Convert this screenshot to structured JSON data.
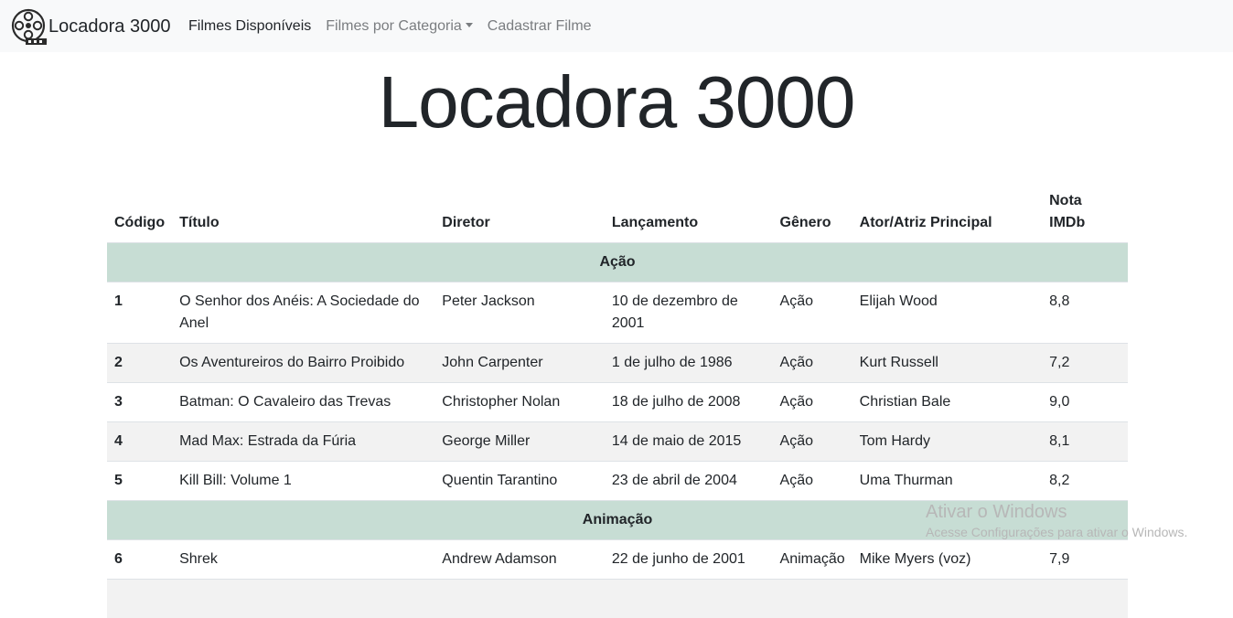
{
  "navbar": {
    "brand": "Locadora 3000",
    "links": [
      {
        "label": "Filmes Disponíveis"
      },
      {
        "label": "Filmes por Categoria"
      },
      {
        "label": "Cadastrar Filme"
      }
    ]
  },
  "page": {
    "title": "Locadora 3000"
  },
  "table": {
    "headers": [
      "Código",
      "Título",
      "Diretor",
      "Lançamento",
      "Gênero",
      "Ator/Atriz Principal",
      "Nota IMDb"
    ],
    "groups": [
      {
        "name": "Ação",
        "rows": [
          {
            "code": "1",
            "title": "O Senhor dos Anéis: A Sociedade do Anel",
            "director": "Peter Jackson",
            "release": "10 de dezembro de 2001",
            "genre": "Ação",
            "actor": "Elijah Wood",
            "rating": "8,8"
          },
          {
            "code": "2",
            "title": "Os Aventureiros do Bairro Proibido",
            "director": "John Carpenter",
            "release": "1 de julho de 1986",
            "genre": "Ação",
            "actor": "Kurt Russell",
            "rating": "7,2"
          },
          {
            "code": "3",
            "title": "Batman: O Cavaleiro das Trevas",
            "director": "Christopher Nolan",
            "release": "18 de julho de 2008",
            "genre": "Ação",
            "actor": "Christian Bale",
            "rating": "9,0"
          },
          {
            "code": "4",
            "title": "Mad Max: Estrada da Fúria",
            "director": "George Miller",
            "release": "14 de maio de 2015",
            "genre": "Ação",
            "actor": "Tom Hardy",
            "rating": "8,1"
          },
          {
            "code": "5",
            "title": "Kill Bill: Volume 1",
            "director": "Quentin Tarantino",
            "release": "23 de abril de 2004",
            "genre": "Ação",
            "actor": "Uma Thurman",
            "rating": "8,2"
          }
        ]
      },
      {
        "name": "Animação",
        "rows": [
          {
            "code": "6",
            "title": "Shrek",
            "director": "Andrew Adamson",
            "release": "22 de junho de 2001",
            "genre": "Animação",
            "actor": "Mike Myers (voz)",
            "rating": "7,9"
          }
        ]
      }
    ]
  },
  "watermark": {
    "title": "Ativar o Windows",
    "subtitle": "Acesse Configurações para ativar o Windows."
  },
  "colors": {
    "navbar_bg": "#f8f9fa",
    "group_row_bg": "#c7ddd4",
    "striped_row_bg": "#f2f2f2",
    "border": "#dee2e6"
  },
  "icons": {
    "brand": "film-reel-icon",
    "dropdown": "caret-down-icon"
  }
}
